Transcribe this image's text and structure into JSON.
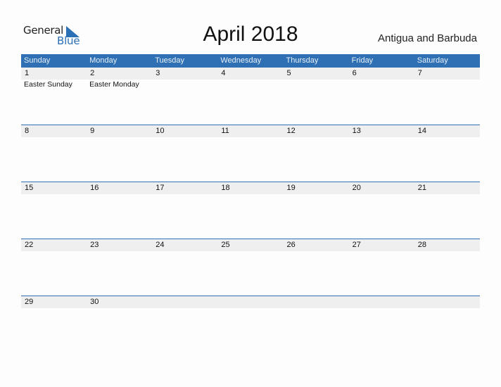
{
  "logo": {
    "word1": "General",
    "word2": "Blue",
    "brand_color": "#2b6fb5"
  },
  "header": {
    "title": "April 2018",
    "country": "Antigua and Barbuda"
  },
  "calendar": {
    "header_color": "#2e70b3",
    "days": [
      "Sunday",
      "Monday",
      "Tuesday",
      "Wednesday",
      "Thursday",
      "Friday",
      "Saturday"
    ],
    "weeks": [
      {
        "dates": [
          "1",
          "2",
          "3",
          "4",
          "5",
          "6",
          "7"
        ],
        "events": [
          "Easter Sunday",
          "Easter Monday",
          "",
          "",
          "",
          "",
          ""
        ]
      },
      {
        "dates": [
          "8",
          "9",
          "10",
          "11",
          "12",
          "13",
          "14"
        ],
        "events": [
          "",
          "",
          "",
          "",
          "",
          "",
          ""
        ]
      },
      {
        "dates": [
          "15",
          "16",
          "17",
          "18",
          "19",
          "20",
          "21"
        ],
        "events": [
          "",
          "",
          "",
          "",
          "",
          "",
          ""
        ]
      },
      {
        "dates": [
          "22",
          "23",
          "24",
          "25",
          "26",
          "27",
          "28"
        ],
        "events": [
          "",
          "",
          "",
          "",
          "",
          "",
          ""
        ]
      },
      {
        "dates": [
          "29",
          "30",
          "",
          "",
          "",
          "",
          ""
        ],
        "events": [
          "",
          "",
          "",
          "",
          "",
          "",
          ""
        ]
      }
    ]
  }
}
